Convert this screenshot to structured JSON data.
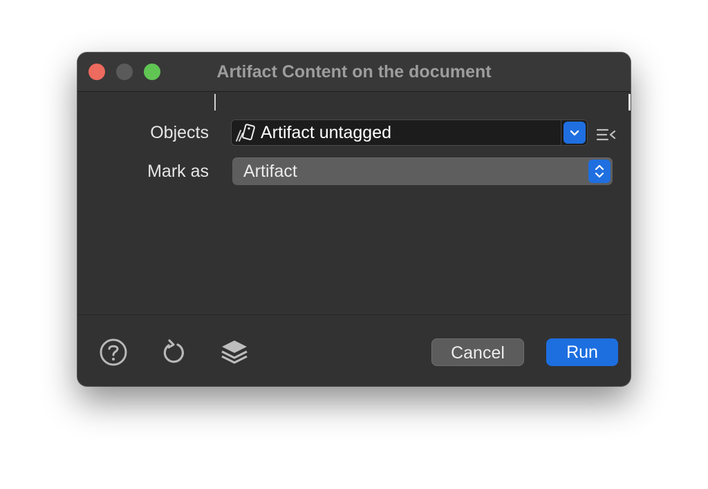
{
  "window": {
    "title": "Artifact Content on the document"
  },
  "form": {
    "objects_label": "Objects",
    "objects_value": "Artifact untagged",
    "mark_as_label": "Mark as",
    "mark_as_value": "Artifact"
  },
  "footer": {
    "cancel_label": "Cancel",
    "run_label": "Run"
  },
  "icons": {
    "objects_field": "artifact-object-icon",
    "combo": "chevron-down-icon",
    "options_menu": "list-collapse-icon",
    "stepper": "up-down-chevron-icon",
    "help": "question-circle-icon",
    "reset": "refresh-icon",
    "layers": "layers-icon"
  },
  "colors": {
    "window_bg": "#323232",
    "titlebar_bg": "#383838",
    "accent": "#1d6fe0",
    "close": "#ed6a5e",
    "minimize": "#5a5a5a",
    "maximize": "#61c554"
  }
}
